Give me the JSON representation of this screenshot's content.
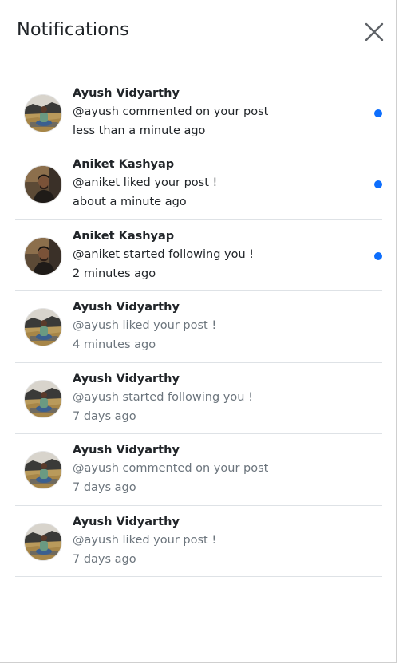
{
  "header": {
    "title": "Notifications",
    "close_icon": "close-icon"
  },
  "colors": {
    "unread_dot": "#0d6efd",
    "text_primary": "#212529",
    "text_muted": "#6c757d",
    "divider": "#dee2e6"
  },
  "notifications": [
    {
      "name": "Ayush Vidyarthy",
      "message": "@ayush commented on your post",
      "time": "less than a minute ago",
      "unread": true,
      "avatar": "ayush"
    },
    {
      "name": "Aniket Kashyap",
      "message": "@aniket liked your post !",
      "time": "about a minute ago",
      "unread": true,
      "avatar": "aniket"
    },
    {
      "name": "Aniket Kashyap",
      "message": "@aniket started following you !",
      "time": "2 minutes ago",
      "unread": true,
      "avatar": "aniket"
    },
    {
      "name": "Ayush Vidyarthy",
      "message": "@ayush liked your post !",
      "time": "4 minutes ago",
      "unread": false,
      "avatar": "ayush"
    },
    {
      "name": "Ayush Vidyarthy",
      "message": "@ayush started following you !",
      "time": "7 days ago",
      "unread": false,
      "avatar": "ayush"
    },
    {
      "name": "Ayush Vidyarthy",
      "message": "@ayush commented on your post",
      "time": "7 days ago",
      "unread": false,
      "avatar": "ayush"
    },
    {
      "name": "Ayush Vidyarthy",
      "message": "@ayush liked your post !",
      "time": "7 days ago",
      "unread": false,
      "avatar": "ayush"
    }
  ]
}
